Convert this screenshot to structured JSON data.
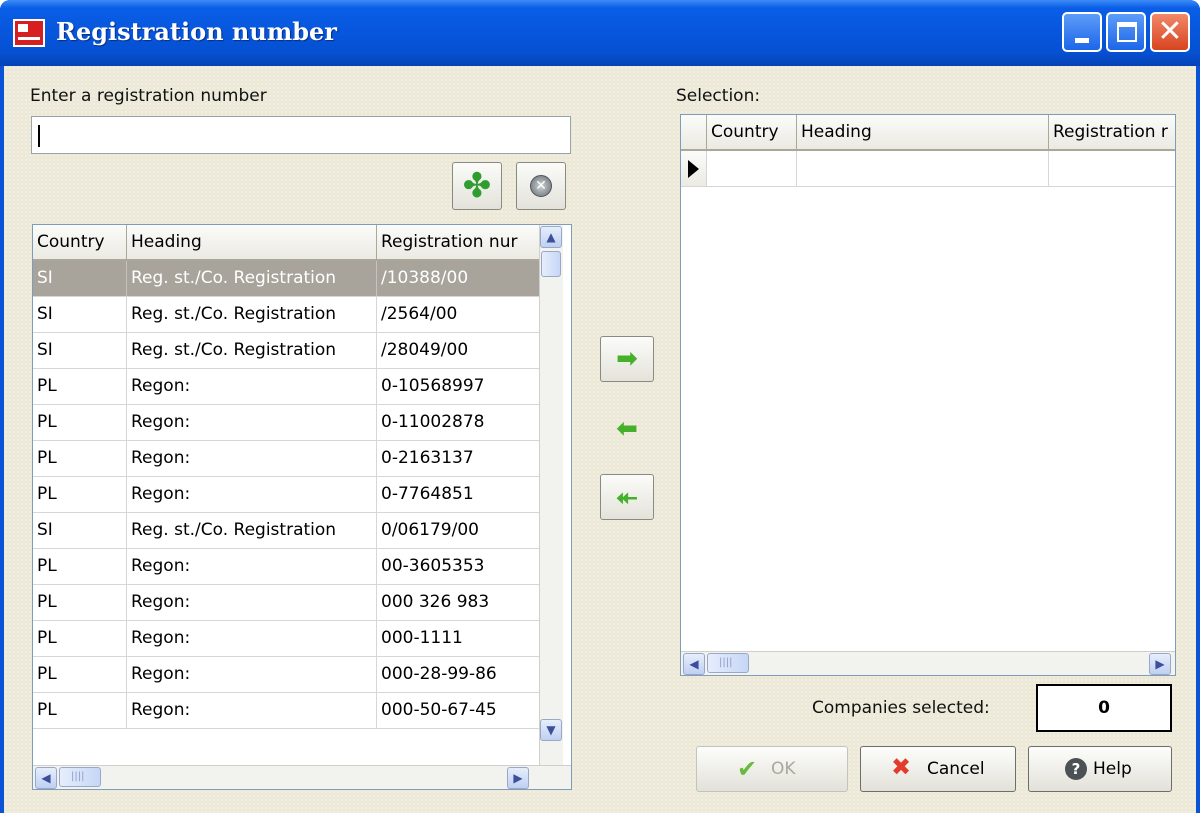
{
  "window": {
    "title": "Registration number",
    "close_glyph": "✕"
  },
  "search": {
    "label": "Enter a registration number",
    "value": "",
    "placeholder": ""
  },
  "search_buttons": {
    "wildcard_icon": "clover-icon",
    "clear_icon": "clear-circle-icon",
    "clear_glyph": "✕"
  },
  "results_grid": {
    "columns": [
      "Country",
      "Heading",
      "Registration nur"
    ],
    "rows": [
      [
        "SI",
        "Reg. st./Co. Registration",
        "/10388/00"
      ],
      [
        "SI",
        "Reg. st./Co. Registration",
        "/2564/00"
      ],
      [
        "SI",
        "Reg. st./Co. Registration",
        "/28049/00"
      ],
      [
        "PL",
        "Regon:",
        "0-10568997"
      ],
      [
        "PL",
        "Regon:",
        "0-11002878"
      ],
      [
        "PL",
        "Regon:",
        "0-2163137"
      ],
      [
        "PL",
        "Regon:",
        "0-7764851"
      ],
      [
        "SI",
        "Reg. st./Co. Registration",
        "0/06179/00"
      ],
      [
        "PL",
        "Regon:",
        "00-3605353"
      ],
      [
        "PL",
        "Regon:",
        "000 326 983"
      ],
      [
        "PL",
        "Regon:",
        "000-1111"
      ],
      [
        "PL",
        "Regon:",
        "000-28-99-86"
      ],
      [
        "PL",
        "Regon:",
        "000-50-67-45"
      ]
    ],
    "selected_row": 0
  },
  "transfer": {
    "add_glyph": "➡",
    "remove_glyph": "⬅",
    "remove_all_glyph": "⯬"
  },
  "selection": {
    "label": "Selection:",
    "columns": [
      "Country",
      "Heading",
      "Registration r"
    ]
  },
  "scroll_glyphs": {
    "up": "▲",
    "down": "▼",
    "left": "◀",
    "right": "▶",
    "grip": "||||"
  },
  "companies": {
    "label": "Companies selected:",
    "count": "0"
  },
  "buttons": {
    "ok_label": "OK",
    "ok_glyph": "✔",
    "cancel_label": "Cancel",
    "cancel_glyph": "✖",
    "help_label": "Help",
    "help_glyph": "?"
  },
  "colors": {
    "titlebar": "#0757de",
    "client_bg": "#ece9d8",
    "selected_row": "#a8a39b",
    "arrow_green": "#45b12a",
    "cancel_red": "#e43c2c"
  }
}
